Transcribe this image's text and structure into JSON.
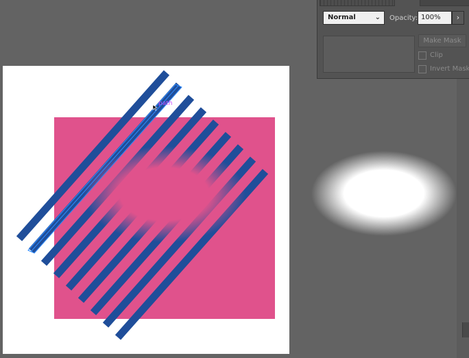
{
  "canvas": {
    "artboard_color": "#ffffff",
    "rectangle_color": "#e0528c",
    "stripe_color": "#1f4e9a",
    "selection_color": "#2f8cff",
    "path_label": "path"
  },
  "transparency_panel": {
    "blend_mode": "Normal",
    "opacity_label": "Opacity:",
    "opacity_value": "100%",
    "make_mask_label": "Make Mask",
    "clip_label": "Clip",
    "invert_mask_label": "Invert Mask"
  }
}
